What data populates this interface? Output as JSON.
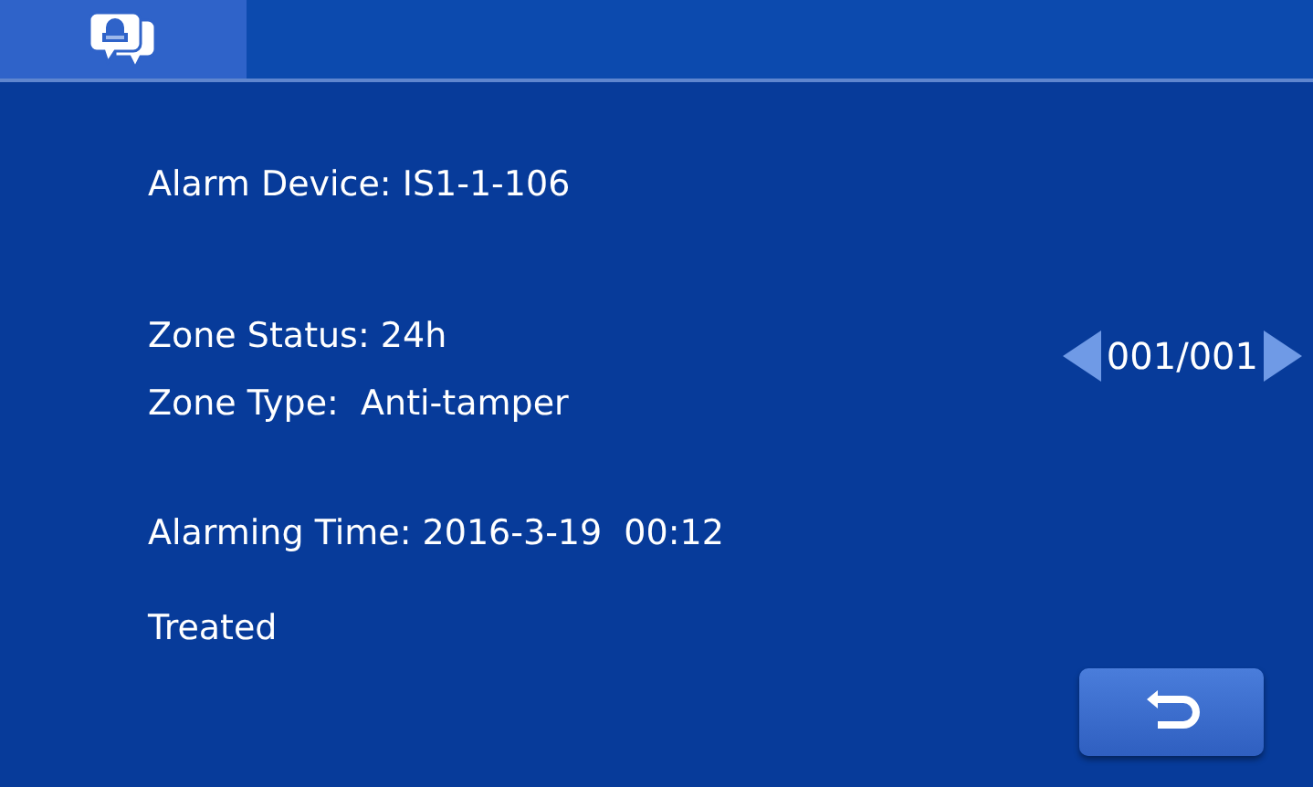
{
  "tabs": [
    {
      "selected": true
    }
  ],
  "groups": [
    [
      "Alarm Device: IS1-1-106"
    ],
    [
      "Zone Status: 24h",
      "Zone Type:  Anti-tamper"
    ],
    [
      "Alarming Time: 2016-3-19  00:12"
    ],
    [
      "Treated"
    ]
  ],
  "pager": {
    "text": "001/001"
  }
}
